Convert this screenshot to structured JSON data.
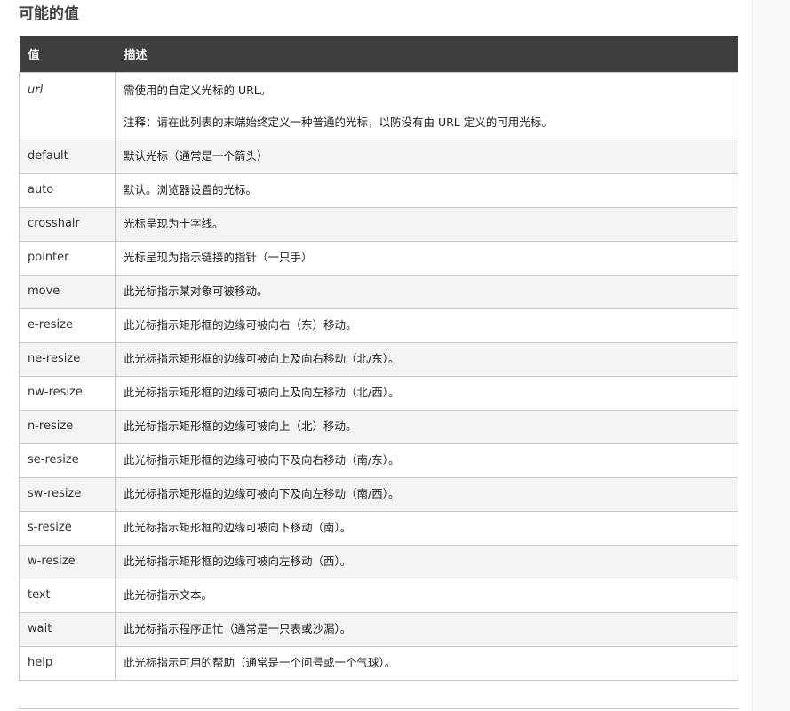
{
  "section": {
    "title": "可能的值"
  },
  "table": {
    "headers": {
      "value": "值",
      "description": "描述"
    },
    "first_row": {
      "value": "url",
      "description": "需使用的自定义光标的 URL。",
      "note": "注释：请在此列表的末端始终定义一种普通的光标，以防没有由 URL 定义的可用光标。"
    },
    "rows": [
      {
        "value": "default",
        "description": "默认光标（通常是一个箭头）"
      },
      {
        "value": "auto",
        "description": "默认。浏览器设置的光标。"
      },
      {
        "value": "crosshair",
        "description": "光标呈现为十字线。"
      },
      {
        "value": "pointer",
        "description": "光标呈现为指示链接的指针（一只手）"
      },
      {
        "value": "move",
        "description": "此光标指示某对象可被移动。"
      },
      {
        "value": "e-resize",
        "description": "此光标指示矩形框的边缘可被向右（东）移动。"
      },
      {
        "value": "ne-resize",
        "description": "此光标指示矩形框的边缘可被向上及向右移动（北/东）。"
      },
      {
        "value": "nw-resize",
        "description": "此光标指示矩形框的边缘可被向上及向左移动（北/西）。"
      },
      {
        "value": "n-resize",
        "description": "此光标指示矩形框的边缘可被向上（北）移动。"
      },
      {
        "value": "se-resize",
        "description": "此光标指示矩形框的边缘可被向下及向右移动（南/东）。"
      },
      {
        "value": "sw-resize",
        "description": "此光标指示矩形框的边缘可被向下及向左移动（南/西）。"
      },
      {
        "value": "s-resize",
        "description": "此光标指示矩形框的边缘可被向下移动（南）。"
      },
      {
        "value": "w-resize",
        "description": "此光标指示矩形框的边缘可被向左移动（西）。"
      },
      {
        "value": "text",
        "description": "此光标指示文本。"
      },
      {
        "value": "wait",
        "description": "此光标指示程序正忙（通常是一只表或沙漏）。"
      },
      {
        "value": "help",
        "description": "此光标指示可用的帮助（通常是一个问号或一个气球）。"
      }
    ]
  },
  "colors": {
    "header_bg": "#3e3e3e",
    "header_text": "#ffffff",
    "alt_row_bg": "#f4f4f4",
    "border": "#c9c9c9"
  }
}
